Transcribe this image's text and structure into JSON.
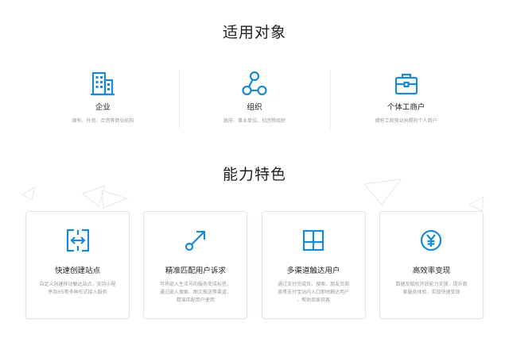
{
  "audience": {
    "title": "适用对象",
    "items": [
      {
        "name": "企业",
        "desc": "国有、外资、合资等商业机构",
        "icon": "office-building-icon"
      },
      {
        "name": "组织",
        "desc": "政府、事业单位、社团等组织",
        "icon": "org-network-icon"
      },
      {
        "name": "个体工商户",
        "desc": "拥有工商营业执照的个人商户",
        "icon": "toolbox-icon"
      }
    ]
  },
  "features": {
    "title": "能力特色",
    "cards": [
      {
        "name": "快速创建站点",
        "desc_lines": [
          "自定义创建移动触达站点，支持小程",
          "序及H5等多种形式接入服务"
        ],
        "icon": "expand-arrows-icon"
      },
      {
        "name": "精准匹配用户诉求",
        "desc_lines": [
          "可将嵌入生活号的服务变成标签，",
          "通过嵌入搜索、图文推送等渠道，",
          "精准匹配用户使用"
        ],
        "icon": "arrow-up-right-icon"
      },
      {
        "name": "多渠道触达用户",
        "desc_lines": [
          "通过支付完成页、搜索、朋友页商",
          "息等支付宝站内入口即时触达用户",
          "，帮助商家获客"
        ],
        "icon": "layout-grid-icon"
      },
      {
        "name": "高效率变现",
        "desc_lines": [
          "数据及赋权开放能力支撑，提升商",
          "家服务体验，实现快速变现"
        ],
        "icon": "yen-coin-icon"
      }
    ]
  },
  "colors": {
    "accent": "#1a8ad4",
    "title": "#1f1f1f",
    "desc": "#9a9a9a"
  }
}
